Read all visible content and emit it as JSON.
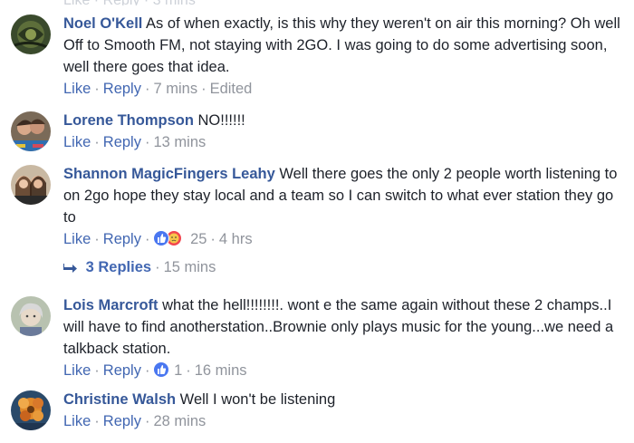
{
  "comments": [
    {
      "name": "Noel O'Kell",
      "text": "As of when exactly, is this why they weren't on air this morning? Oh well Off to Smooth FM, not staying with 2GO. I was going to do some advertising soon, well there goes that idea.",
      "like": "Like",
      "reply": "Reply",
      "time": "7 mins",
      "edited": "Edited",
      "avatar_icon": "dark-swirl-avatar-icon"
    },
    {
      "name": "Lorene Thompson",
      "text": "NO!!!!!!",
      "like": "Like",
      "reply": "Reply",
      "time": "13 mins",
      "avatar_icon": "couple-photo-avatar-icon"
    },
    {
      "name": "Shannon MagicFingers Leahy",
      "text": "Well there goes the only 2 people worth listening to on 2go hope they stay local and a team so I can switch to what ever station they go to",
      "like": "Like",
      "reply": "Reply",
      "reactions": "25",
      "time": "4 hrs",
      "avatar_icon": "women-photo-avatar-icon"
    },
    {
      "name": "Lois Marcroft",
      "text": "what the hell!!!!!!!!. wont e the same again without these 2 champs..I will have to find anotherstation..Brownie only plays music for the young...we need a talkback station.",
      "like": "Like",
      "reply": "Reply",
      "reactions": "1",
      "time": "16 mins",
      "avatar_icon": "grey-hair-avatar-icon"
    },
    {
      "name": "Christine Walsh",
      "text": "Well I won't be listening",
      "like": "Like",
      "reply": "Reply",
      "time": "28 mins",
      "avatar_icon": "flower-photo-avatar-icon"
    }
  ],
  "replies": {
    "label": "3 Replies",
    "time": "15 mins"
  },
  "colors": {
    "name": "#365899",
    "link": "#4267b2",
    "meta": "#90949c",
    "text": "#1d2129",
    "like_reaction": "#4a77f0",
    "sad_reaction": "#f2454f"
  }
}
